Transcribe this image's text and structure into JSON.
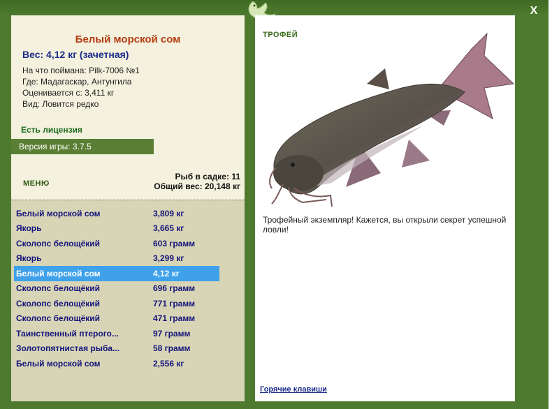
{
  "window": {
    "close_label": "X"
  },
  "fish": {
    "title": "Белый морской сом",
    "weight": "Вес: 4,12 кг (зачетная)",
    "caught_with": "На что поймана: Pilk-7006 №1",
    "where": "Где: Мадагаскар, Антунгила",
    "estimated": "Оценивается с: 3,411 кг",
    "kind": "Вид: Ловится редко"
  },
  "license": "Есть лицензия",
  "version": "Версия игры: 3.7.5",
  "menu_label": "МЕНЮ",
  "cage": {
    "count": "Рыб в садке: 11",
    "total_weight": "Общий вес: 20,148 кг"
  },
  "fish_list": [
    {
      "name": "Белый морской сом",
      "weight": "3,809 кг"
    },
    {
      "name": "Якорь",
      "weight": "3,665 кг"
    },
    {
      "name": "Сколопс белощёкий",
      "weight": "603 грамм"
    },
    {
      "name": "Якорь",
      "weight": "3,299 кг"
    },
    {
      "name": "Белый морской сом",
      "weight": "4,12 кг"
    },
    {
      "name": "Сколопс белощёкий",
      "weight": "696 грамм"
    },
    {
      "name": "Сколопс белощёкий",
      "weight": "771 грамм"
    },
    {
      "name": "Сколопс белощёкий",
      "weight": "471 грамм"
    },
    {
      "name": "Таинственный птерого...",
      "weight": "97 грамм"
    },
    {
      "name": "Золотопятнистая рыба...",
      "weight": "58 грамм"
    },
    {
      "name": "Белый морской сом",
      "weight": "2,556 кг"
    }
  ],
  "selected_index": 4,
  "trophy": {
    "title": "ТРОФЕЙ",
    "text": "Трофейный экземпляр! Кажется, вы открыли секрет успешной ловли!"
  },
  "hotkeys_label": "Горячие клавиши",
  "colors": {
    "frame": "#4d7a2e",
    "selected_row": "#3ea1ea",
    "title_red": "#b43c10",
    "list_text": "#14147a"
  },
  "icons": {
    "logo": "lizard-logo-icon",
    "close": "close-icon"
  }
}
